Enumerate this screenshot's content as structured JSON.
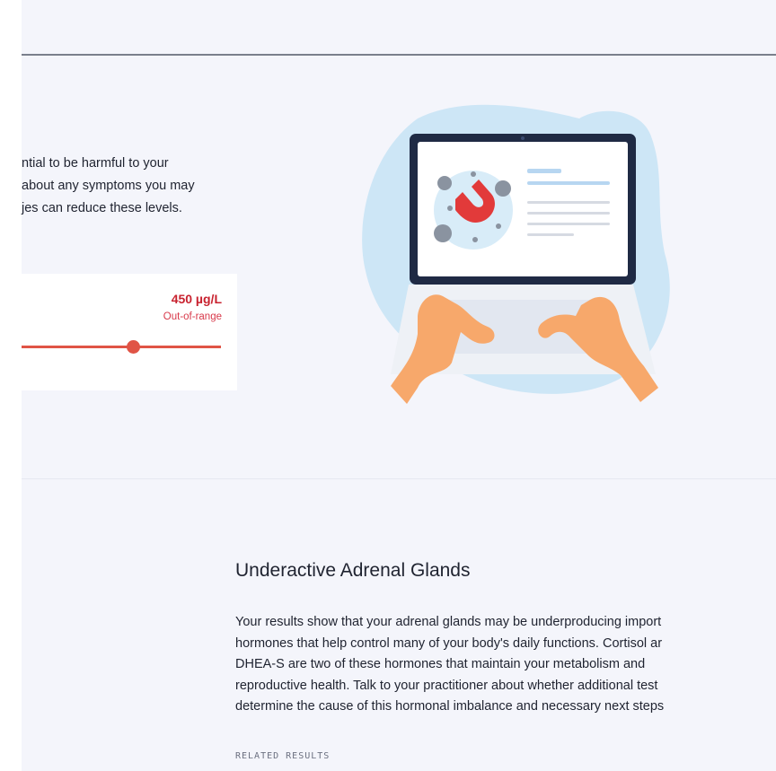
{
  "description": {
    "lines": [
      "ntial to be harmful to your",
      "about any symptoms you may",
      "jes can reduce these levels."
    ]
  },
  "range": {
    "value": "450 µg/L",
    "status": "Out-of-range",
    "status_color": "#d8394a",
    "value_color": "#c8222f",
    "track_color": "#e05446",
    "marker_fraction": 0.56
  },
  "illustration": {
    "icon": "laptop-magnet-illustration",
    "blob_color": "#cde6f6",
    "screen_bezel_color": "#1f2a44"
  },
  "section": {
    "title": "Underactive Adrenal Glands",
    "body_lines": [
      "Your results show that your adrenal glands may be underproducing import",
      "hormones that help control many of your body's daily functions. Cortisol ar",
      "DHEA-S are two of these hormones that maintain your metabolism and",
      "reproductive health. Talk to your practitioner about whether additional test",
      "determine the cause of this hormonal imbalance and necessary next steps"
    ],
    "related_label": "RELATED RESULTS"
  }
}
